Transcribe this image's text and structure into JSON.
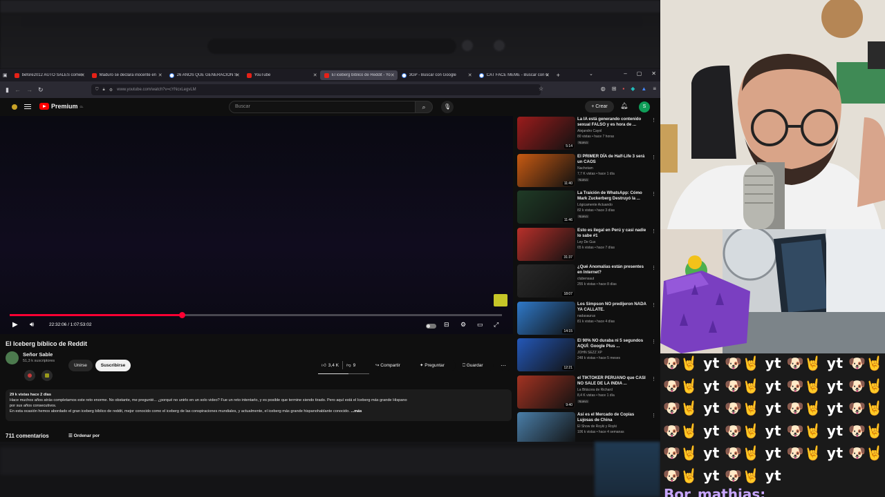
{
  "browser": {
    "tabs": [
      {
        "label": "before2012 AUTO SALES comer",
        "icon": "youtube-icon"
      },
      {
        "label": "Maduro se declara inocente en",
        "icon": "youtube-icon"
      },
      {
        "label": "26 AÑOS QUE GENERACION S",
        "icon": "google-icon"
      },
      {
        "label": "YouTube",
        "icon": "youtube-icon"
      },
      {
        "label": "El iceberg bíblico de Reddit - Yo",
        "icon": "youtube-icon",
        "active": true
      },
      {
        "label": "3GP - Buscar con Google",
        "icon": "google-icon"
      },
      {
        "label": "CAT FACE MEME - Buscar con G",
        "icon": "google-icon"
      }
    ],
    "url": "www.youtube.com/watch?v=cYNcxLegvLM"
  },
  "youtube": {
    "logo_text": "Premium",
    "logo_sup": "CL",
    "search_placeholder": "Buscar",
    "create_label": "+ Crear",
    "avatar_letter": "S",
    "player": {
      "time": "22:32:06 / 1:07:53:02",
      "progress_fraction": 0.35
    },
    "video_title": "El Iceberg bíblico de Reddit",
    "channel_name": "Señor Sable",
    "channel_subs": "51,3 k suscriptores",
    "join_label": "Unirse",
    "subscribe_label": "Suscribirse",
    "likes": "3,4 K",
    "dislikes": "9",
    "share_label": "Compartir",
    "ask_label": "Preguntar",
    "save_label": "Guardar",
    "description": {
      "meta": "29 k vistas  hace 2 días",
      "line1": "Hace muchos años atrás completamos este reto enorme. No obstante, me pregunté... ¿porqué no unirlo en un solo video? Fue un reto intentarlo, y es posible que termine siendo tirado. Pero aquí está el Iceberg más grande Hispano",
      "line2": "por sus años consecutivos.",
      "line3": "En esta ocasión hemos abordado el gran iceberg bíblico de reddit, mejor conocido como el iceberg de las conspiraciones mundiales, y actualmente, el iceberg más grande hispanohablante conocido.",
      "more": "...más"
    },
    "comments_count": "711 comentarios",
    "sort_label": "Ordenar por",
    "recommendations": [
      {
        "title": "La IA está generando contenido sexual FALSO y es hora de ...",
        "channel": "Alejandro Cayol",
        "views": "80 vistas • hace 7 horas",
        "badge": "Nuevo",
        "duration": "5:14",
        "thumb_color": "#9b1c1c"
      },
      {
        "title": "El PRIMER DÍA de Half-Life 3 será un CAOS",
        "channel": "Nachotam",
        "views": "7,7 K vistas • hace 1 día",
        "badge": "Nuevo",
        "duration": "11:40",
        "thumb_color": "#c75a12"
      },
      {
        "title": "La Traición de WhatsApp: Cómo Mark Zuckerberg Destruyó la ...",
        "channel": "Lógicamente Actuando",
        "views": "82 k vistas • hace 3 días",
        "badge": "Nuevo",
        "duration": "11:46",
        "thumb_color": "#1f3b26"
      },
      {
        "title": "Esto es ilegal en Perú y casi nadie lo sabe #1",
        "channel": "Ley De Gus",
        "views": "65 k vistas • hace 7 días",
        "badge": "",
        "duration": "31:37",
        "thumb_color": "#b8302a"
      },
      {
        "title": "¿Qué Anomalías están presentes en Internet?",
        "channel": "clubensaut",
        "views": "255 k vistas • hace 8 días",
        "badge": "",
        "duration": "18:07",
        "thumb_color": "#2a2a2a"
      },
      {
        "title": "Los Simpson NO predijeron NADA YA CALLATE.",
        "channel": "nadasaurus",
        "views": "81 k vistas • hace 4 días",
        "badge": "",
        "duration": "14:15",
        "thumb_color": "#2f79c9"
      },
      {
        "title": "El 90% NO duraba ni 5 segundos AQUÍ: Google Plus ...",
        "channel": "JOHN SEZZ XP",
        "views": "248 k vistas • hace 5 meses",
        "badge": "",
        "duration": "12:21",
        "thumb_color": "#2458b8"
      },
      {
        "title": "el TIKTOKER PERUANO que CASI NO SALE DE LA INDIA ...",
        "channel": "La Bitácora de Richard",
        "views": "8,4 K vistas • hace 1 día",
        "badge": "Nuevo",
        "duration": "9:40",
        "thumb_color": "#a33322"
      },
      {
        "title": "Así es el Mercado de Copias Lujosas de China",
        "channel": "El Show de Royki y Royki",
        "views": "106 k vistas • hace 4 semanas",
        "badge": "",
        "duration": "",
        "thumb_color": "#4a7ea8"
      }
    ]
  },
  "chat": {
    "lines": [
      "🐶🤘 yt 🐶🤘 yt 🐶🤘 yt 🐶🤘 yt",
      "🐶🤘 yt 🐶🤘 yt 🐶🤘 yt 🐶🤘 yt",
      "🐶🤘 yt 🐶🤘 yt 🐶🤘 yt 🐶🤘 yt",
      "🐶🤘 yt 🐶🤘 yt 🐶🤘 yt 🐶🤘 yt",
      "🐶🤘 yt 🐶🤘 yt 🐶🤘 yt 🐶🤘 yt",
      "🐶🤘 yt 🐶🤘 yt"
    ],
    "next_user": "Bor_mathias:"
  }
}
